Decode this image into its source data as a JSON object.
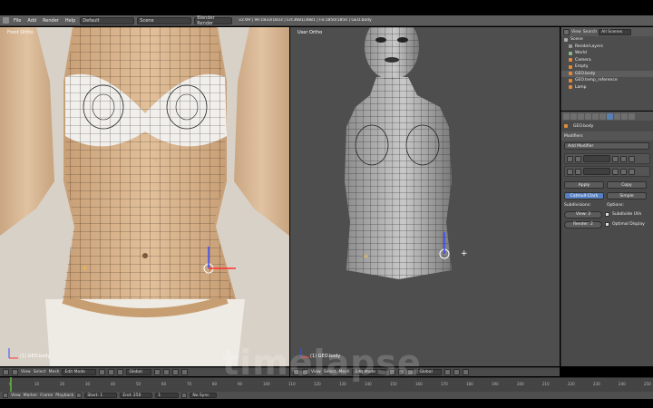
{
  "topbar": {
    "menus": [
      "File",
      "Add",
      "Render",
      "Help"
    ],
    "screen": "Default",
    "scene": "Scene",
    "engine": "Blender Render",
    "stats": "v2.69 | Ve:1833/1833 | Ed:3681/3681 | Fa:1850/1850 | GEO.body"
  },
  "left_view": {
    "label": "Front Ortho",
    "object": "(1) GEO.body"
  },
  "right_view": {
    "label": "User Ortho",
    "object": "(1) GEO.body"
  },
  "left_header": {
    "menus": [
      "View",
      "Select",
      "Mesh"
    ],
    "mode": "Edit Mode",
    "orientation": "Global"
  },
  "right_header": {
    "menus": [
      "View",
      "Select",
      "Mesh"
    ],
    "mode": "Edit Mode",
    "orientation": "Global"
  },
  "outliner": {
    "menus": [
      "View",
      "Search"
    ],
    "scope": "All Scenes",
    "items": [
      "Scene",
      "RenderLayers",
      "World",
      "Camera",
      "Empty",
      "GEO.body",
      "GEO.temp_reference",
      "Lamp"
    ]
  },
  "properties": {
    "object_name": "GEO.body",
    "section": "Modifiers",
    "add_modifier": "Add Modifier",
    "apply": "Apply",
    "copy": "Copy",
    "catmull": "Catmull-Clark",
    "simple": "Simple",
    "subdivisions_label": "Subdivisions:",
    "options_label": "Options:",
    "view_field": "View: 3",
    "render_field": "Render: 2",
    "subdivide_uvs": "Subdivide UVs",
    "optimal_display": "Optimal Display"
  },
  "timeline": {
    "ticks": [
      "0",
      "10",
      "20",
      "30",
      "40",
      "50",
      "60",
      "70",
      "80",
      "90",
      "100",
      "110",
      "120",
      "130",
      "140",
      "150",
      "160",
      "170",
      "180",
      "190",
      "200",
      "210",
      "220",
      "230",
      "240",
      "250"
    ]
  },
  "bottombar": {
    "menus": [
      "View",
      "Marker",
      "Frame",
      "Playback"
    ],
    "start": "Start: 1",
    "end": "End: 250",
    "current": "1",
    "sync": "No Sync"
  },
  "watermark": "timelapse",
  "colors": {
    "accent": "#5680c2",
    "selected_row": "#e08a3a",
    "frame_cursor": "#5a9a3a"
  }
}
